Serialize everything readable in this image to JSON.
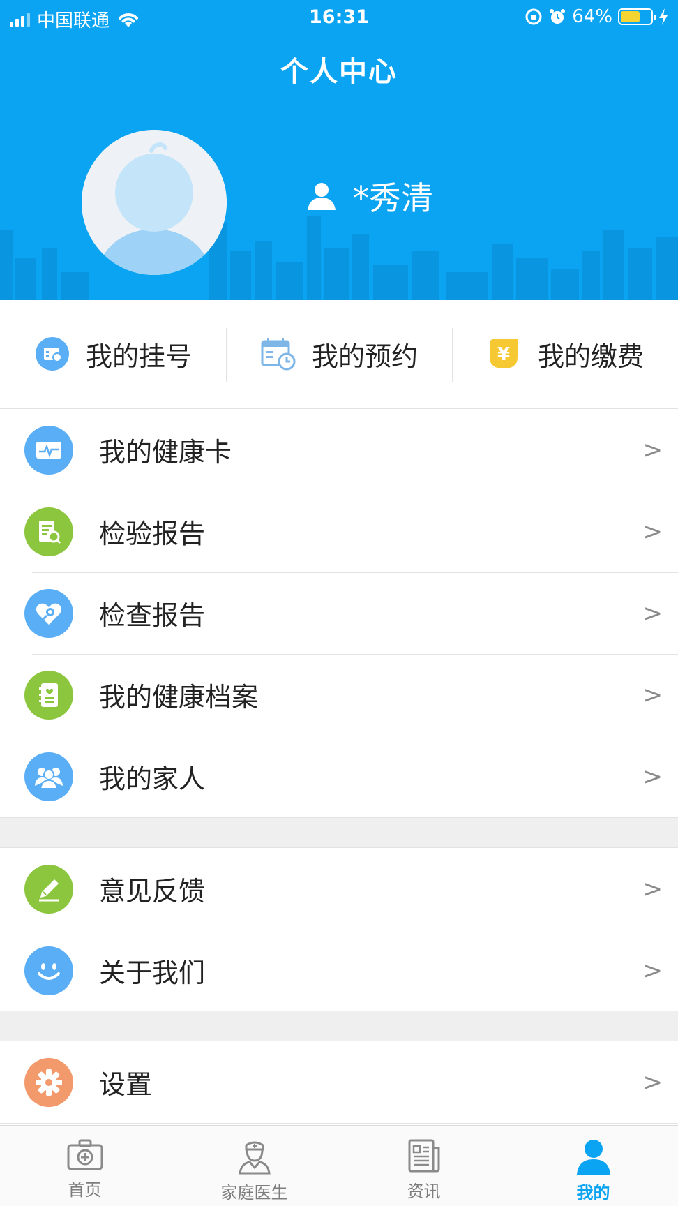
{
  "status_bar": {
    "carrier": "中国联通",
    "time": "16:31",
    "battery_percent": "64%",
    "battery_level": 0.64
  },
  "header": {
    "title": "个人中心",
    "username": "*秀清"
  },
  "quick_actions": [
    {
      "label": "我的挂号",
      "icon": "registration-icon"
    },
    {
      "label": "我的预约",
      "icon": "calendar-clock-icon"
    },
    {
      "label": "我的缴费",
      "icon": "yuan-payment-icon"
    }
  ],
  "menu_group_1": [
    {
      "label": "我的健康卡",
      "icon": "health-card-icon",
      "color": "#5aaef5"
    },
    {
      "label": "检验报告",
      "icon": "lab-report-icon",
      "color": "#8cc63f"
    },
    {
      "label": "检查报告",
      "icon": "heart-search-icon",
      "color": "#5aaef5"
    },
    {
      "label": "我的健康档案",
      "icon": "health-record-icon",
      "color": "#8cc63f"
    },
    {
      "label": "我的家人",
      "icon": "family-icon",
      "color": "#5aaef5"
    }
  ],
  "menu_group_2": [
    {
      "label": "意见反馈",
      "icon": "pencil-icon",
      "color": "#8cc63f"
    },
    {
      "label": "关于我们",
      "icon": "smile-icon",
      "color": "#5aaef5"
    }
  ],
  "menu_group_3": [
    {
      "label": "设置",
      "icon": "gear-icon",
      "color": "#f29a6b"
    }
  ],
  "chevron": ">",
  "tabbar": [
    {
      "label": "首页",
      "icon": "medical-kit-icon",
      "active": false
    },
    {
      "label": "家庭医生",
      "icon": "doctor-icon",
      "active": false
    },
    {
      "label": "资讯",
      "icon": "news-icon",
      "active": false
    },
    {
      "label": "我的",
      "icon": "person-icon",
      "active": true
    }
  ],
  "colors": {
    "brand_blue": "#0aa4f3",
    "green": "#8cc63f",
    "light_blue": "#5aaef5",
    "orange": "#f29a6b",
    "yellow": "#f6c932"
  }
}
